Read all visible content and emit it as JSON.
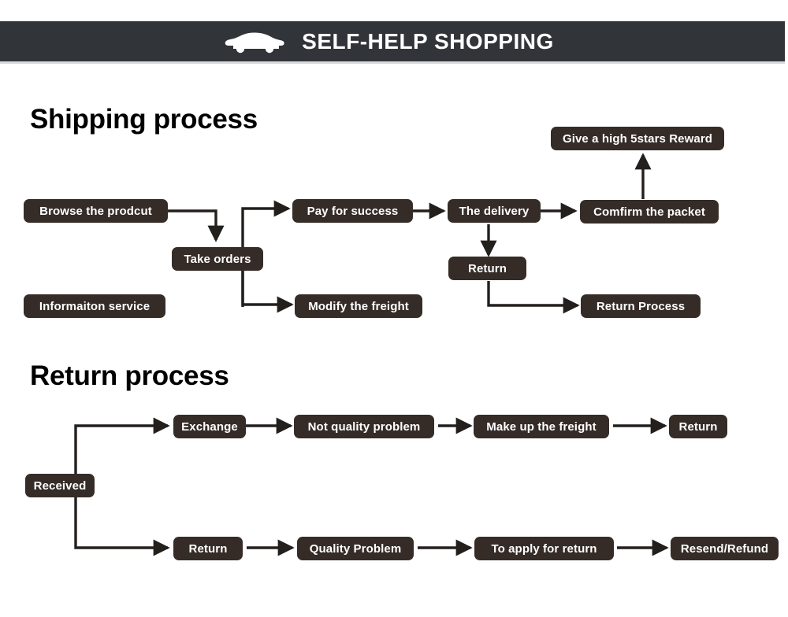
{
  "header": {
    "title": "SELF-HELP SHOPPING",
    "icon": "car-icon",
    "background_color": "#313539",
    "text_color": "#ffffff"
  },
  "theme": {
    "node_fill": "#352c28",
    "node_text": "#ffffff",
    "page_background": "#ffffff",
    "connector_color": "#231f1d"
  },
  "sections": [
    {
      "id": "shipping",
      "title": "Shipping process",
      "nodes": [
        {
          "id": "browse",
          "label": "Browse the prodcut"
        },
        {
          "id": "info-service",
          "label": "Informaiton service"
        },
        {
          "id": "take-orders",
          "label": "Take orders"
        },
        {
          "id": "pay-success",
          "label": "Pay for success"
        },
        {
          "id": "modify-freight",
          "label": "Modify the freight"
        },
        {
          "id": "delivery",
          "label": "The delivery"
        },
        {
          "id": "return",
          "label": "Return"
        },
        {
          "id": "confirm-packet",
          "label": "Comfirm the packet"
        },
        {
          "id": "return-process",
          "label": "Return Process"
        },
        {
          "id": "reward",
          "label": "Give a high 5stars Reward"
        }
      ]
    },
    {
      "id": "return",
      "title": "Return process",
      "nodes": [
        {
          "id": "received",
          "label": "Received"
        },
        {
          "id": "exchange",
          "label": "Exchange"
        },
        {
          "id": "not-quality",
          "label": "Not quality problem"
        },
        {
          "id": "make-up-freight",
          "label": "Make up the freight"
        },
        {
          "id": "return-top",
          "label": "Return"
        },
        {
          "id": "return-bottom",
          "label": "Return"
        },
        {
          "id": "quality-problem",
          "label": "Quality Problem"
        },
        {
          "id": "apply-return",
          "label": "To apply for return"
        },
        {
          "id": "resend-refund",
          "label": "Resend/Refund"
        }
      ]
    }
  ]
}
